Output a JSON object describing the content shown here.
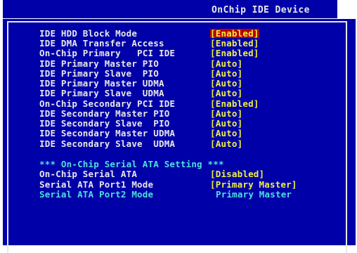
{
  "title": "OnChip IDE Device",
  "colors": {
    "background": "#0000a8",
    "label": "#e8e8e8",
    "value": "#f0f040",
    "highlight": "#b80000",
    "section": "#4ee0e0"
  },
  "settings": [
    {
      "label": "IDE HDD Block Mode",
      "value": "[Enabled]"
    },
    {
      "label": "IDE DMA Transfer Access",
      "value": "[Enabled]"
    },
    {
      "label": "On-Chip Primary   PCI IDE",
      "value": "[Enabled]"
    },
    {
      "label": "IDE Primary Master PIO",
      "value": "[Auto]"
    },
    {
      "label": "IDE Primary Slave  PIO",
      "value": "[Auto]"
    },
    {
      "label": "IDE Primary Master UDMA",
      "value": "[Auto]"
    },
    {
      "label": "IDE Primary Slave  UDMA",
      "value": "[Auto]"
    },
    {
      "label": "On-Chip Secondary PCI IDE",
      "value": "[Enabled]"
    },
    {
      "label": "IDE Secondary Master PIO",
      "value": "[Auto]"
    },
    {
      "label": "IDE Secondary Slave  PIO",
      "value": "[Auto]"
    },
    {
      "label": "IDE Secondary Master UDMA",
      "value": "[Auto]"
    },
    {
      "label": "IDE Secondary Slave  UDMA",
      "value": "[Auto]"
    }
  ],
  "sata_section": {
    "heading": "*** On-Chip Serial ATA Setting ***",
    "items": [
      {
        "label": "On-Chip Serial ATA",
        "value": "[Disabled]"
      },
      {
        "label": "Serial ATA Port1 Mode",
        "value": "[Primary Master]"
      },
      {
        "label": "Serial ATA Port2 Mode",
        "value": "Primary Master"
      }
    ]
  }
}
